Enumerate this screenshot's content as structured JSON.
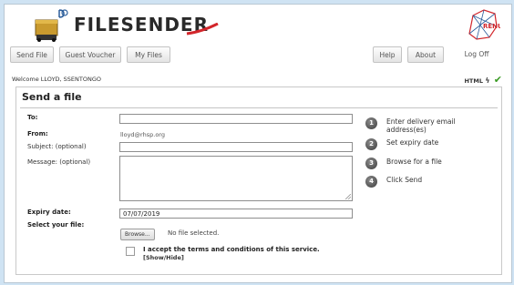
{
  "header": {
    "brand": "FILESENDER",
    "partner_logo_text": "RENU"
  },
  "nav": {
    "send_file": "Send File",
    "guest_voucher": "Guest Voucher",
    "my_files": "My Files",
    "help": "Help",
    "about": "About",
    "log_off": "Log Off"
  },
  "status": {
    "welcome": "Welcome LLOYD, SSENTONGO",
    "html5": "HTML",
    "html5_check": "✔"
  },
  "form": {
    "title": "Send a file",
    "to_label": "To:",
    "to_value": "",
    "from_label": "From:",
    "from_value": "lloyd@rhsp.org",
    "subject_label": "Subject: (optional)",
    "subject_value": "",
    "message_label": "Message: (optional)",
    "message_value": "",
    "expiry_label": "Expiry date:",
    "expiry_value": "07/07/2019",
    "select_label": "Select your file:",
    "browse_label": "Browse...",
    "no_file": "No file selected.",
    "terms_text": "I accept the terms and conditions of this service.",
    "terms_link": "[Show/Hide]",
    "terms_checked": false
  },
  "steps": [
    {
      "number": "1",
      "text": "Enter delivery email address(es)"
    },
    {
      "number": "2",
      "text": "Set expiry date"
    },
    {
      "number": "3",
      "text": "Browse for a file"
    },
    {
      "number": "4",
      "text": "Click Send"
    }
  ],
  "colors": {
    "page_background": "#cfe3f3",
    "check_green": "#3a9b24",
    "swoosh_red": "#d3262b"
  }
}
